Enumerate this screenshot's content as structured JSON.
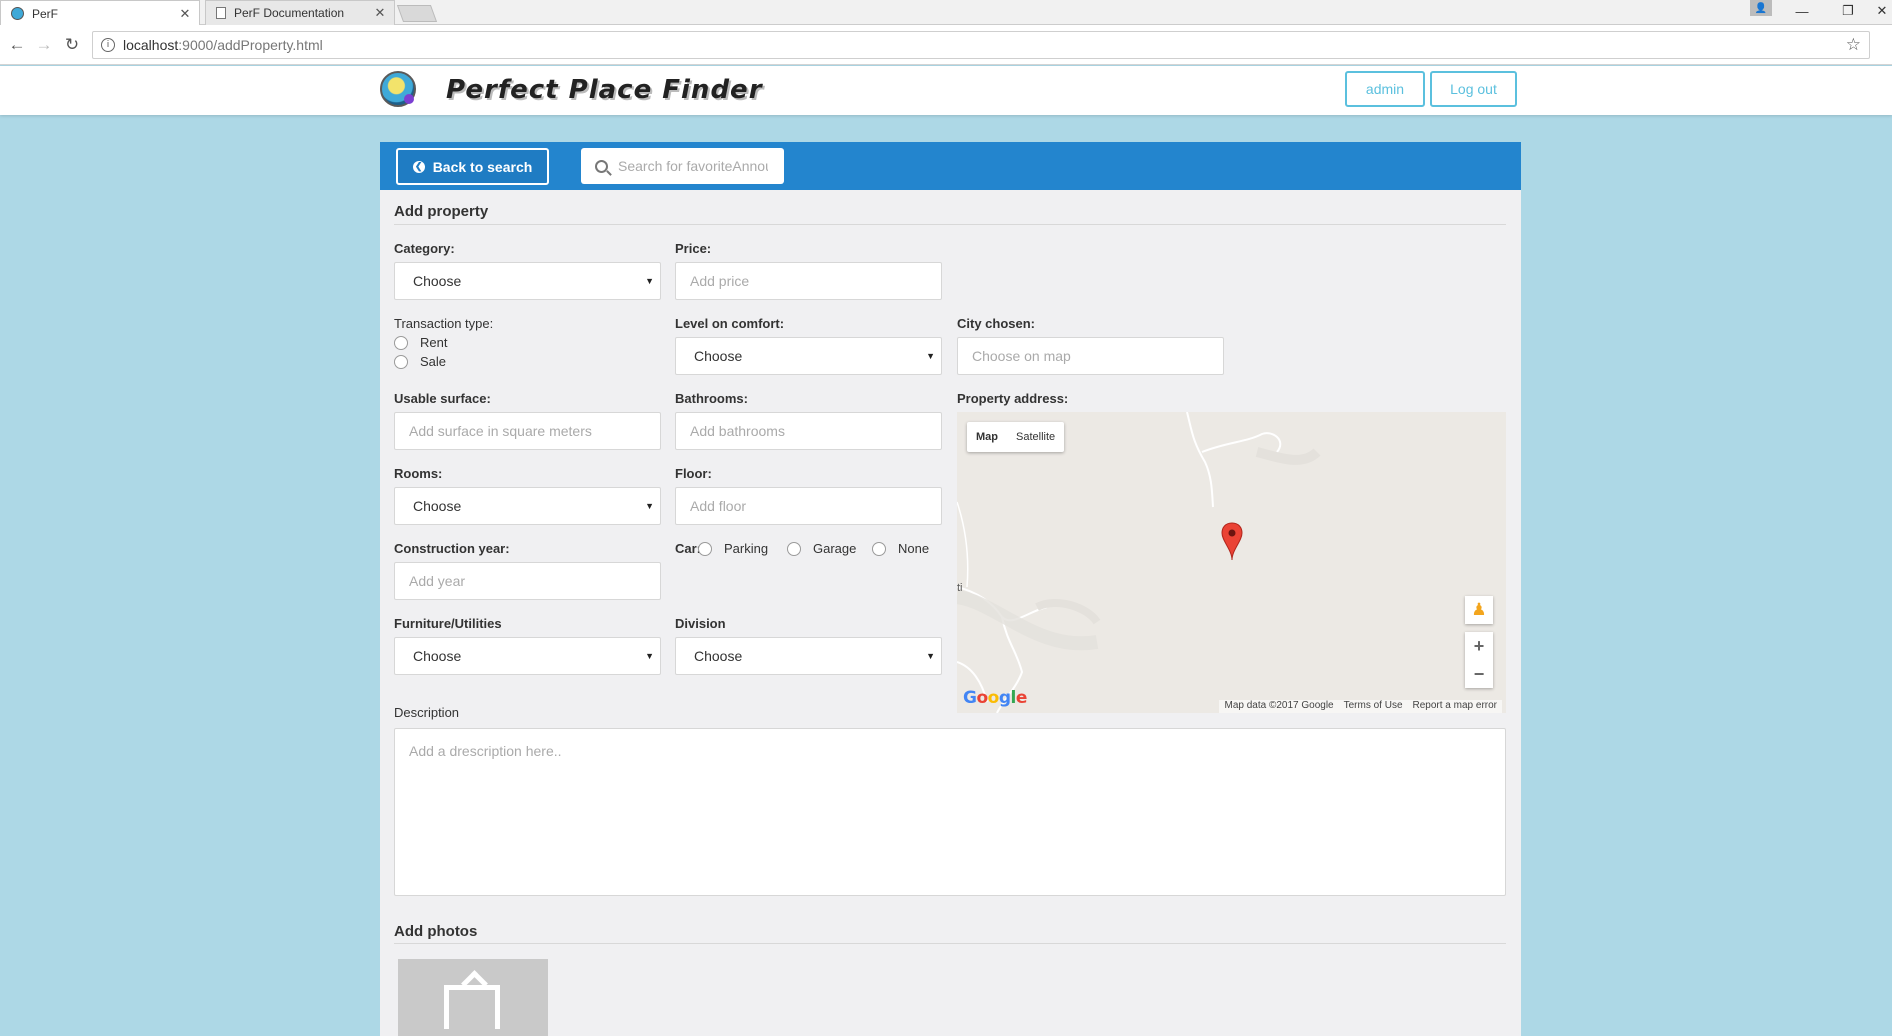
{
  "browser": {
    "tabs": [
      {
        "title": "PerF",
        "active": true
      },
      {
        "title": "PerF Documentation",
        "active": false
      }
    ],
    "url_host": "localhost",
    "url_path": ":9000/addProperty.html"
  },
  "header": {
    "brand": "Perfect Place Finder",
    "admin_label": "admin",
    "logout_label": "Log out"
  },
  "toolbar": {
    "back_label": "Back to search",
    "search_placeholder": "Search for favoriteAnnouncements"
  },
  "form": {
    "title": "Add property",
    "category": {
      "label": "Category:",
      "value": "Choose"
    },
    "price": {
      "label": "Price:",
      "placeholder": "Add price"
    },
    "transaction": {
      "label": "Transaction type:",
      "options": [
        "Rent",
        "Sale"
      ]
    },
    "comfort": {
      "label": "Level on comfort:",
      "value": "Choose"
    },
    "city": {
      "label": "City chosen:",
      "placeholder": "Choose on map"
    },
    "surface": {
      "label": "Usable surface:",
      "placeholder": "Add surface in square meters"
    },
    "bathrooms": {
      "label": "Bathrooms:",
      "placeholder": "Add bathrooms"
    },
    "address": {
      "label": "Property address:"
    },
    "rooms": {
      "label": "Rooms:",
      "value": "Choose"
    },
    "floor": {
      "label": "Floor:",
      "placeholder": "Add floor"
    },
    "year": {
      "label": "Construction year:",
      "placeholder": "Add year"
    },
    "car": {
      "label": "Car:",
      "options": [
        "Parking",
        "Garage",
        "None"
      ]
    },
    "furniture": {
      "label": "Furniture/Utilities",
      "value": "Choose"
    },
    "division": {
      "label": "Division",
      "value": "Choose"
    },
    "description": {
      "label": "Description",
      "placeholder": "Add a drescription here.."
    },
    "photos_title": "Add photos"
  },
  "map": {
    "type_map": "Map",
    "type_satellite": "Satellite",
    "google": "Google",
    "attrib": [
      "Map data ©2017 Google",
      "Terms of Use",
      "Report a map error"
    ],
    "place_label": "ti",
    "colors": {
      "land": "#ece9e4",
      "road": "#ffffff",
      "marker": "#ea4335"
    }
  }
}
